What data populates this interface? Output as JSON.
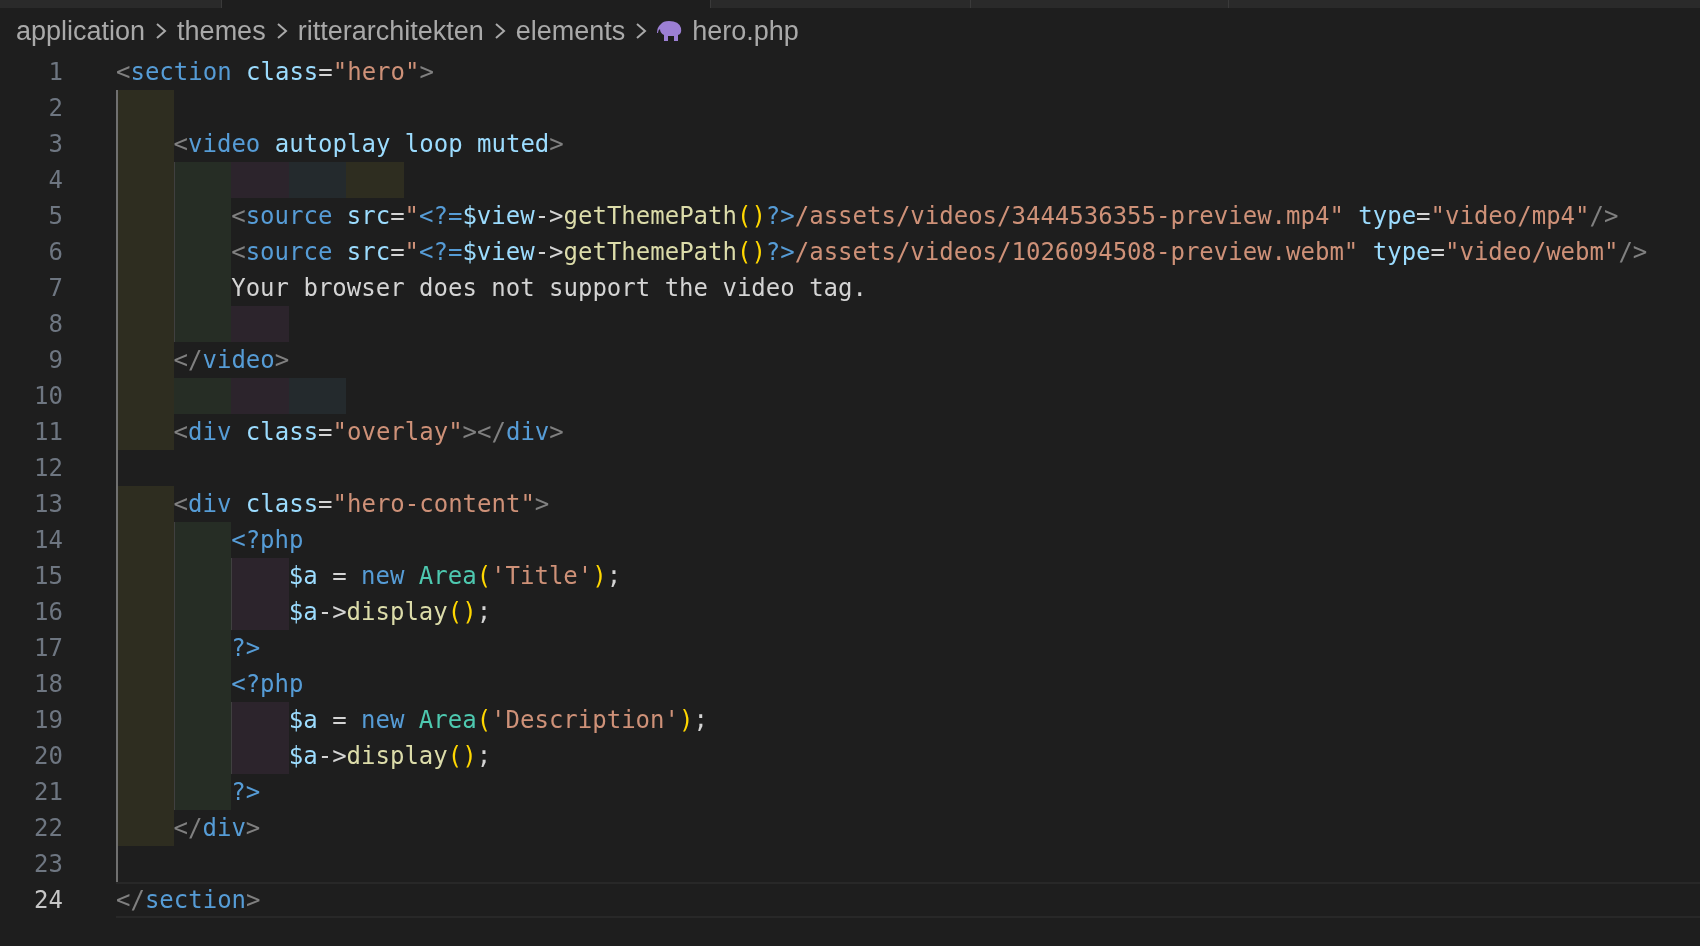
{
  "tabs": [
    {
      "selected": false
    },
    {
      "selected": true
    },
    {
      "selected": false
    },
    {
      "selected": false
    },
    {
      "selected": false
    }
  ],
  "breadcrumb": [
    {
      "label": "application",
      "kind": "folder"
    },
    {
      "label": "themes",
      "kind": "folder"
    },
    {
      "label": "ritterarchitekten",
      "kind": "folder"
    },
    {
      "label": "elements",
      "kind": "folder"
    },
    {
      "label": "hero.php",
      "kind": "php-file"
    }
  ],
  "lines": [
    {
      "number": "1",
      "current": false,
      "tokens": [
        {
          "kind": "punct",
          "text": "<"
        },
        {
          "kind": "tag",
          "text": "section"
        },
        {
          "kind": "attr",
          "text": " class"
        },
        {
          "kind": "op",
          "text": "="
        },
        {
          "kind": "string",
          "text": "\"hero\""
        },
        {
          "kind": "punct",
          "text": ">"
        }
      ]
    },
    {
      "number": "2",
      "current": false,
      "indent": [
        {
          "kind": "fill",
          "color": "#2e2d20",
          "guide": true
        }
      ]
    },
    {
      "number": "3",
      "current": false,
      "indent": [
        {
          "kind": "fill",
          "color": "#2e2d20",
          "guide": true
        }
      ],
      "tokens": [
        {
          "kind": "punct",
          "text": "<"
        },
        {
          "kind": "tag",
          "text": "video"
        },
        {
          "kind": "attr",
          "text": " autoplay"
        },
        {
          "kind": "attr",
          "text": " loop"
        },
        {
          "kind": "attr",
          "text": " muted"
        },
        {
          "kind": "punct",
          "text": ">"
        }
      ]
    },
    {
      "number": "4",
      "current": false,
      "indent": [
        {
          "kind": "fill",
          "color": "#2e2d20",
          "guide": true
        },
        {
          "kind": "fill",
          "color": "#262d25",
          "guide": true
        },
        {
          "kind": "fill",
          "color": "#2c242c",
          "guide": false
        },
        {
          "kind": "fill",
          "color": "#242a2d",
          "guide": false
        },
        {
          "kind": "fill",
          "color": "#2e2d20",
          "guide": false
        }
      ]
    },
    {
      "number": "5",
      "current": false,
      "indent": [
        {
          "kind": "fill",
          "color": "#2e2d20",
          "guide": true
        },
        {
          "kind": "fill",
          "color": "#262d25",
          "guide": true
        }
      ],
      "tokens": [
        {
          "kind": "punct",
          "text": "<"
        },
        {
          "kind": "tag",
          "text": "source"
        },
        {
          "kind": "attr",
          "text": " src"
        },
        {
          "kind": "op",
          "text": "="
        },
        {
          "kind": "string",
          "text": "\""
        },
        {
          "kind": "php",
          "text": "<?="
        },
        {
          "kind": "var",
          "text": "$view"
        },
        {
          "kind": "op",
          "text": "->"
        },
        {
          "kind": "func",
          "text": "getThemePath"
        },
        {
          "kind": "paren",
          "text": "()"
        },
        {
          "kind": "php",
          "text": "?>"
        },
        {
          "kind": "string",
          "text": "/assets/videos/3444536355-preview.mp4\""
        },
        {
          "kind": "attr",
          "text": " type"
        },
        {
          "kind": "op",
          "text": "="
        },
        {
          "kind": "string",
          "text": "\"video/mp4\""
        },
        {
          "kind": "punct",
          "text": "/>"
        }
      ]
    },
    {
      "number": "6",
      "current": false,
      "indent": [
        {
          "kind": "fill",
          "color": "#2e2d20",
          "guide": true
        },
        {
          "kind": "fill",
          "color": "#262d25",
          "guide": true
        }
      ],
      "tokens": [
        {
          "kind": "punct",
          "text": "<"
        },
        {
          "kind": "tag",
          "text": "source"
        },
        {
          "kind": "attr",
          "text": " src"
        },
        {
          "kind": "op",
          "text": "="
        },
        {
          "kind": "string",
          "text": "\""
        },
        {
          "kind": "php",
          "text": "<?="
        },
        {
          "kind": "var",
          "text": "$view"
        },
        {
          "kind": "op",
          "text": "->"
        },
        {
          "kind": "func",
          "text": "getThemePath"
        },
        {
          "kind": "paren",
          "text": "()"
        },
        {
          "kind": "php",
          "text": "?>"
        },
        {
          "kind": "string",
          "text": "/assets/videos/1026094508-preview.webm\""
        },
        {
          "kind": "attr",
          "text": " type"
        },
        {
          "kind": "op",
          "text": "="
        },
        {
          "kind": "string",
          "text": "\"video/webm\""
        },
        {
          "kind": "punct",
          "text": "/>"
        }
      ]
    },
    {
      "number": "7",
      "current": false,
      "indent": [
        {
          "kind": "fill",
          "color": "#2e2d20",
          "guide": true
        },
        {
          "kind": "fill",
          "color": "#262d25",
          "guide": true
        }
      ],
      "tokens": [
        {
          "kind": "plain",
          "text": "Your browser does not support the video tag."
        }
      ]
    },
    {
      "number": "8",
      "current": false,
      "indent": [
        {
          "kind": "fill",
          "color": "#2e2d20",
          "guide": true
        },
        {
          "kind": "fill",
          "color": "#262d25",
          "guide": true
        },
        {
          "kind": "fill",
          "color": "#2c242c",
          "guide": false
        }
      ]
    },
    {
      "number": "9",
      "current": false,
      "indent": [
        {
          "kind": "fill",
          "color": "#2e2d20",
          "guide": true
        }
      ],
      "tokens": [
        {
          "kind": "punct",
          "text": "</"
        },
        {
          "kind": "tag",
          "text": "video"
        },
        {
          "kind": "punct",
          "text": ">"
        }
      ]
    },
    {
      "number": "10",
      "current": false,
      "indent": [
        {
          "kind": "fill",
          "color": "#2e2d20",
          "guide": true
        },
        {
          "kind": "fill",
          "color": "#262d25",
          "guide": false
        },
        {
          "kind": "fill",
          "color": "#2c242c",
          "guide": false
        },
        {
          "kind": "fill",
          "color": "#242a2d",
          "guide": false
        }
      ]
    },
    {
      "number": "11",
      "current": false,
      "indent": [
        {
          "kind": "fill",
          "color": "#2e2d20",
          "guide": true
        }
      ],
      "tokens": [
        {
          "kind": "punct",
          "text": "<"
        },
        {
          "kind": "tag",
          "text": "div"
        },
        {
          "kind": "attr",
          "text": " class"
        },
        {
          "kind": "op",
          "text": "="
        },
        {
          "kind": "string",
          "text": "\"overlay\""
        },
        {
          "kind": "punct",
          "text": "></"
        },
        {
          "kind": "tag",
          "text": "div"
        },
        {
          "kind": "punct",
          "text": ">"
        }
      ]
    },
    {
      "number": "12",
      "current": false,
      "indent": [
        {
          "kind": "blank",
          "guide": true
        }
      ]
    },
    {
      "number": "13",
      "current": false,
      "indent": [
        {
          "kind": "fill",
          "color": "#2e2d20",
          "guide": true
        }
      ],
      "tokens": [
        {
          "kind": "punct",
          "text": "<"
        },
        {
          "kind": "tag",
          "text": "div"
        },
        {
          "kind": "attr",
          "text": " class"
        },
        {
          "kind": "op",
          "text": "="
        },
        {
          "kind": "string",
          "text": "\"hero-content\""
        },
        {
          "kind": "punct",
          "text": ">"
        }
      ]
    },
    {
      "number": "14",
      "current": false,
      "indent": [
        {
          "kind": "fill",
          "color": "#2e2d20",
          "guide": true
        },
        {
          "kind": "fill",
          "color": "#262d25",
          "guide": true
        }
      ],
      "tokens": [
        {
          "kind": "php",
          "text": "<?php"
        }
      ]
    },
    {
      "number": "15",
      "current": false,
      "indent": [
        {
          "kind": "fill",
          "color": "#2e2d20",
          "guide": true
        },
        {
          "kind": "fill",
          "color": "#262d25",
          "guide": true
        },
        {
          "kind": "fill",
          "color": "#2c242c",
          "guide": true
        }
      ],
      "tokens": [
        {
          "kind": "var",
          "text": "$a"
        },
        {
          "kind": "op",
          "text": " = "
        },
        {
          "kind": "keyword",
          "text": "new"
        },
        {
          "kind": "class",
          "text": " Area"
        },
        {
          "kind": "paren",
          "text": "("
        },
        {
          "kind": "string",
          "text": "'Title'"
        },
        {
          "kind": "paren",
          "text": ")"
        },
        {
          "kind": "op",
          "text": ";"
        }
      ]
    },
    {
      "number": "16",
      "current": false,
      "indent": [
        {
          "kind": "fill",
          "color": "#2e2d20",
          "guide": true
        },
        {
          "kind": "fill",
          "color": "#262d25",
          "guide": true
        },
        {
          "kind": "fill",
          "color": "#2c242c",
          "guide": true
        }
      ],
      "tokens": [
        {
          "kind": "var",
          "text": "$a"
        },
        {
          "kind": "op",
          "text": "->"
        },
        {
          "kind": "func",
          "text": "display"
        },
        {
          "kind": "paren",
          "text": "()"
        },
        {
          "kind": "op",
          "text": ";"
        }
      ]
    },
    {
      "number": "17",
      "current": false,
      "indent": [
        {
          "kind": "fill",
          "color": "#2e2d20",
          "guide": true
        },
        {
          "kind": "fill",
          "color": "#262d25",
          "guide": true
        }
      ],
      "tokens": [
        {
          "kind": "php",
          "text": "?>"
        }
      ]
    },
    {
      "number": "18",
      "current": false,
      "indent": [
        {
          "kind": "fill",
          "color": "#2e2d20",
          "guide": true
        },
        {
          "kind": "fill",
          "color": "#262d25",
          "guide": true
        }
      ],
      "tokens": [
        {
          "kind": "php",
          "text": "<?php"
        }
      ]
    },
    {
      "number": "19",
      "current": false,
      "indent": [
        {
          "kind": "fill",
          "color": "#2e2d20",
          "guide": true
        },
        {
          "kind": "fill",
          "color": "#262d25",
          "guide": true
        },
        {
          "kind": "fill",
          "color": "#2c242c",
          "guide": true
        }
      ],
      "tokens": [
        {
          "kind": "var",
          "text": "$a"
        },
        {
          "kind": "op",
          "text": " = "
        },
        {
          "kind": "keyword",
          "text": "new"
        },
        {
          "kind": "class",
          "text": " Area"
        },
        {
          "kind": "paren",
          "text": "("
        },
        {
          "kind": "string",
          "text": "'Description'"
        },
        {
          "kind": "paren",
          "text": ")"
        },
        {
          "kind": "op",
          "text": ";"
        }
      ]
    },
    {
      "number": "20",
      "current": false,
      "indent": [
        {
          "kind": "fill",
          "color": "#2e2d20",
          "guide": true
        },
        {
          "kind": "fill",
          "color": "#262d25",
          "guide": true
        },
        {
          "kind": "fill",
          "color": "#2c242c",
          "guide": true
        }
      ],
      "tokens": [
        {
          "kind": "var",
          "text": "$a"
        },
        {
          "kind": "op",
          "text": "->"
        },
        {
          "kind": "func",
          "text": "display"
        },
        {
          "kind": "paren",
          "text": "()"
        },
        {
          "kind": "op",
          "text": ";"
        }
      ]
    },
    {
      "number": "21",
      "current": false,
      "indent": [
        {
          "kind": "fill",
          "color": "#2e2d20",
          "guide": true
        },
        {
          "kind": "fill",
          "color": "#262d25",
          "guide": true
        }
      ],
      "tokens": [
        {
          "kind": "php",
          "text": "?>"
        }
      ]
    },
    {
      "number": "22",
      "current": false,
      "indent": [
        {
          "kind": "fill",
          "color": "#2e2d20",
          "guide": true
        }
      ],
      "tokens": [
        {
          "kind": "punct",
          "text": "</"
        },
        {
          "kind": "tag",
          "text": "div"
        },
        {
          "kind": "punct",
          "text": ">"
        }
      ]
    },
    {
      "number": "23",
      "current": false,
      "indent": [
        {
          "kind": "blank",
          "guide": true
        }
      ]
    },
    {
      "number": "24",
      "current": true,
      "tokens": [
        {
          "kind": "punct",
          "text": "</"
        },
        {
          "kind": "tag",
          "text": "section"
        },
        {
          "kind": "punct",
          "text": ">"
        }
      ]
    }
  ]
}
